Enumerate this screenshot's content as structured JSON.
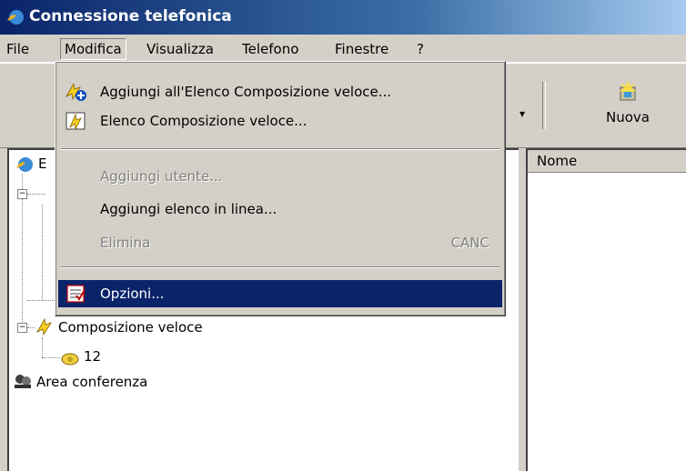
{
  "window": {
    "title": "Connessione telefonica"
  },
  "menubar": {
    "file": "File",
    "modifica": "Modifica",
    "visualizza": "Visualizza",
    "telefono": "Telefono",
    "finestre": "Finestre",
    "help": "?"
  },
  "toolbar": {
    "new_label": "Nuova"
  },
  "list": {
    "column_name": "Nome"
  },
  "tree": {
    "speed_dial": "Composizione veloce",
    "speed_dial_entry": "12",
    "conference": "Area conferenza",
    "root_partial": "E"
  },
  "dropdown": {
    "items": [
      {
        "label": "Aggiungi all'Elenco Composizione veloce...",
        "icon": "speed-dial-add-icon"
      },
      {
        "label": "Elenco Composizione veloce...",
        "icon": "speed-dial-list-icon"
      },
      {
        "label": "Aggiungi utente...",
        "disabled": true
      },
      {
        "label": "Aggiungi elenco in linea..."
      },
      {
        "label": "Elimina",
        "shortcut": "CANC",
        "disabled": true
      },
      {
        "label": "Opzioni...",
        "icon": "options-icon",
        "selected": true
      }
    ]
  },
  "colors": {
    "selection": "#0a246a",
    "title_bar": "#0a246a",
    "face": "#d4d0c8"
  }
}
